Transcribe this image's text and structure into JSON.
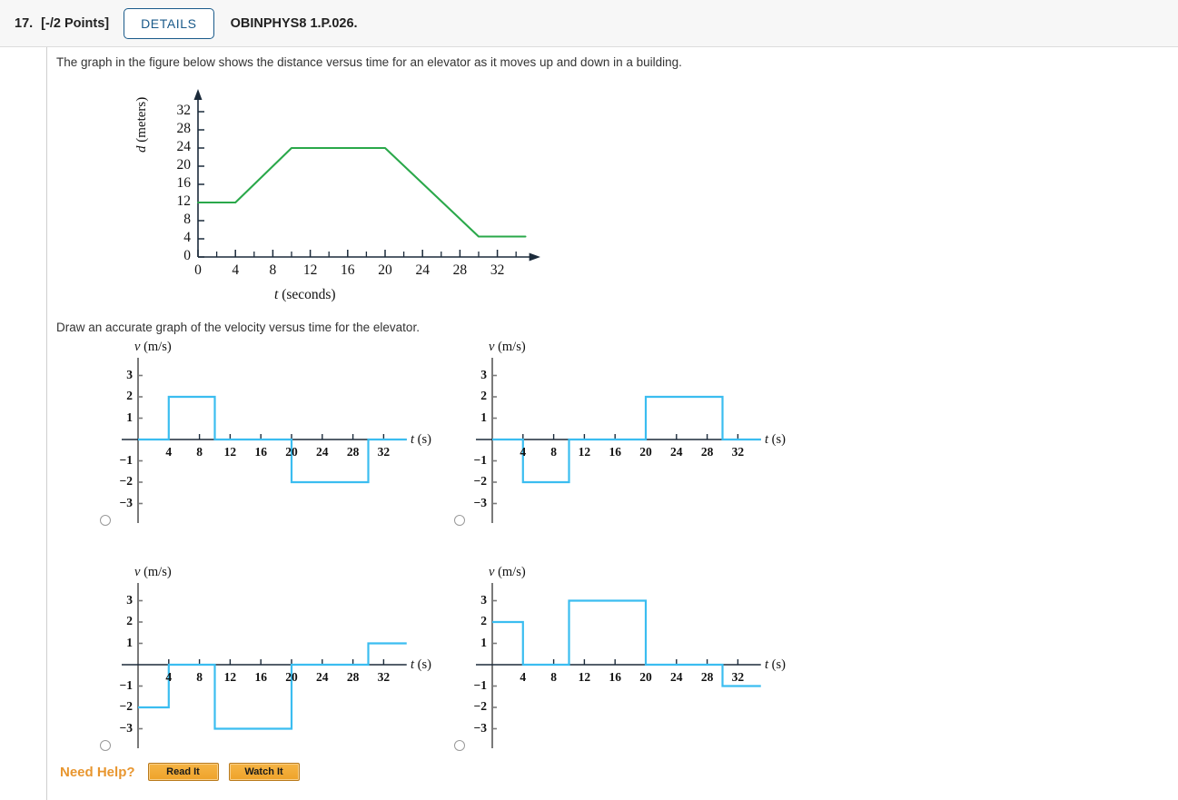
{
  "header": {
    "question_number": "17.",
    "points": "[-/2 Points]",
    "details_label": "DETAILS",
    "question_code": "OBINPHYS8 1.P.026."
  },
  "prompts": {
    "intro": "The graph in the figure below shows the distance versus time for an elevator as it moves up and down in a building.",
    "task": "Draw an accurate graph of the velocity versus time for the elevator."
  },
  "colors": {
    "distance_line": "#2aa84a",
    "velocity_line": "#3bbdf0",
    "axis": "#1b2a3a",
    "vaxis": "#7a7a7a",
    "details_blue": "#1a5a8a",
    "help_orange": "#e8962f",
    "header_bg": "#f7f7f7"
  },
  "need_help": {
    "label": "Need Help?",
    "buttons": [
      {
        "label": "Read It"
      },
      {
        "label": "Watch It"
      }
    ]
  },
  "chart_data": [
    {
      "id": "distance_time",
      "type": "line",
      "title": "",
      "xlabel": "t (seconds)",
      "ylabel": "d (meters)",
      "xlim": [
        0,
        36
      ],
      "ylim": [
        0,
        34
      ],
      "xticks_labeled": [
        0,
        4,
        8,
        12,
        16,
        20,
        24,
        28,
        32
      ],
      "xticks_minor": [
        2,
        6,
        10,
        14,
        18,
        22,
        26,
        30,
        34
      ],
      "yticks": [
        0,
        4,
        8,
        12,
        16,
        20,
        24,
        28,
        32
      ],
      "grid": false,
      "legend": "none",
      "points": [
        {
          "t": 0,
          "d": 12
        },
        {
          "t": 4,
          "d": 12
        },
        {
          "t": 10,
          "d": 24
        },
        {
          "t": 20,
          "d": 24
        },
        {
          "t": 30,
          "d": 4.5
        },
        {
          "t": 35,
          "d": 4.5
        }
      ]
    },
    {
      "id": "option_a",
      "type": "line",
      "title": "",
      "xlabel": "t (s)",
      "ylabel": "v (m/s)",
      "xlim": [
        0,
        36
      ],
      "ylim": [
        -3,
        3
      ],
      "xticks_labeled": [
        4,
        8,
        12,
        16,
        20,
        24,
        28,
        32
      ],
      "yticks": [
        3,
        2,
        1,
        -1,
        -2,
        -3
      ],
      "grid": false,
      "legend": "none",
      "steps": [
        {
          "t_start": 0,
          "t_end": 4,
          "v": 0
        },
        {
          "t_start": 4,
          "t_end": 10,
          "v": 2
        },
        {
          "t_start": 10,
          "t_end": 20,
          "v": 0
        },
        {
          "t_start": 20,
          "t_end": 30,
          "v": -2
        },
        {
          "t_start": 30,
          "t_end": 35,
          "v": 0
        }
      ]
    },
    {
      "id": "option_b",
      "type": "line",
      "title": "",
      "xlabel": "t (s)",
      "ylabel": "v (m/s)",
      "xlim": [
        0,
        36
      ],
      "ylim": [
        -3,
        3
      ],
      "xticks_labeled": [
        4,
        8,
        12,
        16,
        20,
        24,
        28,
        32
      ],
      "yticks": [
        3,
        2,
        1,
        -1,
        -2,
        -3
      ],
      "grid": false,
      "legend": "none",
      "steps": [
        {
          "t_start": 0,
          "t_end": 4,
          "v": 0
        },
        {
          "t_start": 4,
          "t_end": 10,
          "v": -2
        },
        {
          "t_start": 10,
          "t_end": 20,
          "v": 0
        },
        {
          "t_start": 20,
          "t_end": 30,
          "v": 2
        },
        {
          "t_start": 30,
          "t_end": 35,
          "v": 0
        }
      ]
    },
    {
      "id": "option_c",
      "type": "line",
      "title": "",
      "xlabel": "t (s)",
      "ylabel": "v (m/s)",
      "xlim": [
        0,
        36
      ],
      "ylim": [
        -3,
        3
      ],
      "xticks_labeled": [
        4,
        8,
        12,
        16,
        20,
        24,
        28,
        32
      ],
      "yticks": [
        3,
        2,
        1,
        -1,
        -2,
        -3
      ],
      "grid": false,
      "legend": "none",
      "steps": [
        {
          "t_start": 0,
          "t_end": 4,
          "v": -2
        },
        {
          "t_start": 4,
          "t_end": 10,
          "v": 0
        },
        {
          "t_start": 10,
          "t_end": 20,
          "v": -3
        },
        {
          "t_start": 20,
          "t_end": 30,
          "v": 0
        },
        {
          "t_start": 30,
          "t_end": 35,
          "v": 1
        }
      ]
    },
    {
      "id": "option_d",
      "type": "line",
      "title": "",
      "xlabel": "t (s)",
      "ylabel": "v (m/s)",
      "xlim": [
        0,
        36
      ],
      "ylim": [
        -3,
        3
      ],
      "xticks_labeled": [
        4,
        8,
        12,
        16,
        20,
        24,
        28,
        32
      ],
      "yticks": [
        3,
        2,
        1,
        -1,
        -2,
        -3
      ],
      "grid": false,
      "legend": "none",
      "steps": [
        {
          "t_start": 0,
          "t_end": 4,
          "v": 2
        },
        {
          "t_start": 4,
          "t_end": 10,
          "v": 0
        },
        {
          "t_start": 10,
          "t_end": 20,
          "v": 3
        },
        {
          "t_start": 20,
          "t_end": 30,
          "v": 0
        },
        {
          "t_start": 30,
          "t_end": 35,
          "v": -1
        }
      ]
    }
  ]
}
